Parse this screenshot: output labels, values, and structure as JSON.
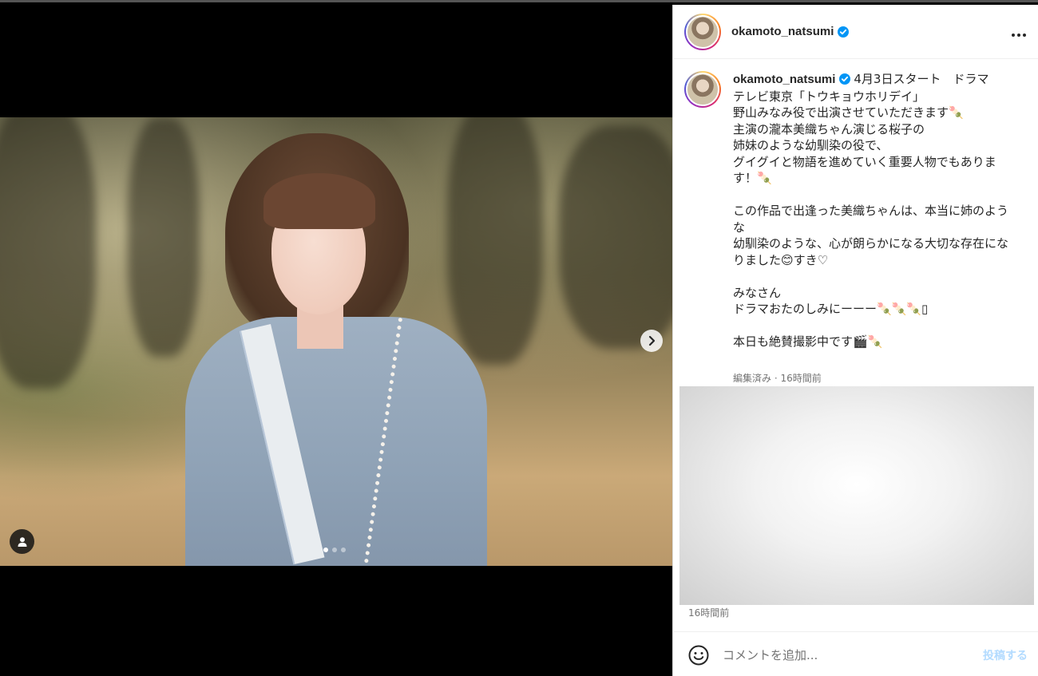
{
  "post": {
    "username": "okamoto_natsumi",
    "verified": true,
    "more_icon": "more-horizontal-icon",
    "caption_lines": [
      "4月3日スタート　ドラマ",
      "テレビ東京「トウキョウホリデイ」",
      "野山みなみ役で出演させていただきます🍡",
      "主演の瀧本美織ちゃん演じる桜子の",
      "姉妹のような幼馴染の役で、",
      "グイグイと物語を進めていく重要人物でもあります！🍡",
      "",
      "この作品で出逢った美織ちゃんは、本当に姉のような",
      "幼馴染のような、心が朗らかになる大切な存在になりました😊すき♡",
      "",
      "みなさん",
      "ドラマおたのしみにーーー🍡🍡🍡▯",
      "",
      "本日も絶賛撮影中です🎬🍡"
    ],
    "meta": "編集済み · 16時間前",
    "time_ago": "16時間前"
  },
  "media": {
    "carousel_total": 3,
    "carousel_active": 1,
    "next_icon": "chevron-right-icon",
    "tag_icon": "user-tag-icon"
  },
  "comment": {
    "emoji_icon": "emoji-icon",
    "placeholder": "コメントを追加...",
    "post_label": "投稿する"
  },
  "colors": {
    "verified": "#0095f6",
    "post_disabled": "#b3dbff",
    "meta_text": "#737373"
  }
}
